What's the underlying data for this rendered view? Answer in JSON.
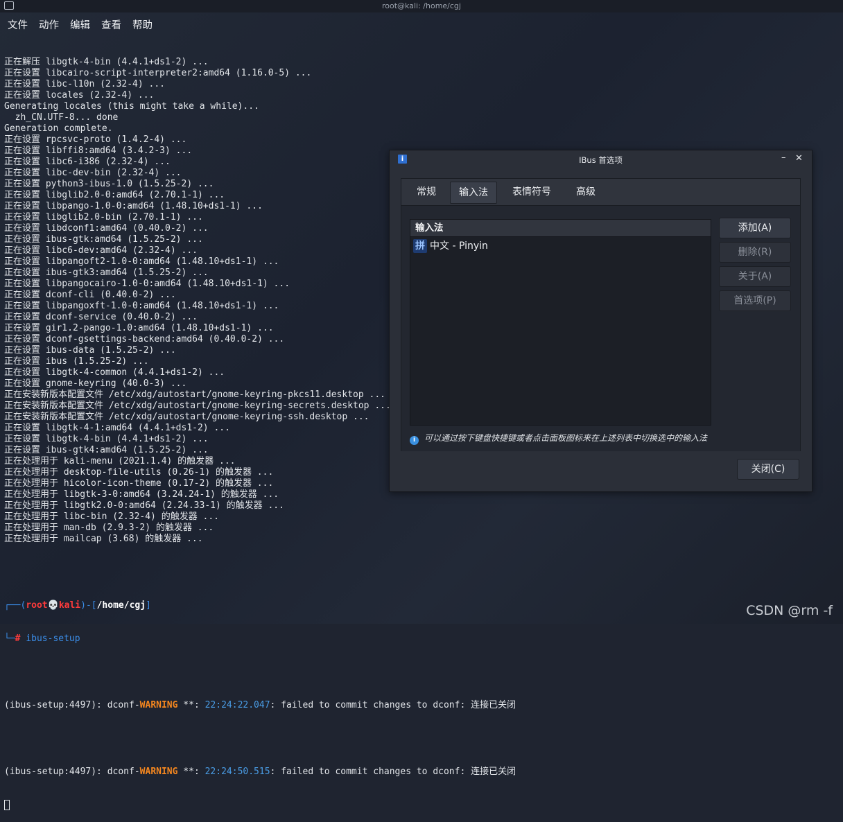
{
  "terminal": {
    "title": "root@kali: /home/cgj",
    "menu": [
      "文件",
      "动作",
      "编辑",
      "查看",
      "帮助"
    ],
    "lines": [
      "正在解压 libgtk-4-bin (4.4.1+ds1-2) ...",
      "正在设置 libcairo-script-interpreter2:amd64 (1.16.0-5) ...",
      "正在设置 libc-l10n (2.32-4) ...",
      "正在设置 locales (2.32-4) ...",
      "Generating locales (this might take a while)...",
      "  zh_CN.UTF-8... done",
      "Generation complete.",
      "正在设置 rpcsvc-proto (1.4.2-4) ...",
      "正在设置 libffi8:amd64 (3.4.2-3) ...",
      "正在设置 libc6-i386 (2.32-4) ...",
      "正在设置 libc-dev-bin (2.32-4) ...",
      "正在设置 python3-ibus-1.0 (1.5.25-2) ...",
      "正在设置 libglib2.0-0:amd64 (2.70.1-1) ...",
      "正在设置 libpango-1.0-0:amd64 (1.48.10+ds1-1) ...",
      "正在设置 libglib2.0-bin (2.70.1-1) ...",
      "正在设置 libdconf1:amd64 (0.40.0-2) ...",
      "正在设置 ibus-gtk:amd64 (1.5.25-2) ...",
      "正在设置 libc6-dev:amd64 (2.32-4) ...",
      "正在设置 libpangoft2-1.0-0:amd64 (1.48.10+ds1-1) ...",
      "正在设置 ibus-gtk3:amd64 (1.5.25-2) ...",
      "正在设置 libpangocairo-1.0-0:amd64 (1.48.10+ds1-1) ...",
      "正在设置 dconf-cli (0.40.0-2) ...",
      "正在设置 libpangoxft-1.0-0:amd64 (1.48.10+ds1-1) ...",
      "正在设置 dconf-service (0.40.0-2) ...",
      "正在设置 gir1.2-pango-1.0:amd64 (1.48.10+ds1-1) ...",
      "正在设置 dconf-gsettings-backend:amd64 (0.40.0-2) ...",
      "正在设置 ibus-data (1.5.25-2) ...",
      "正在设置 ibus (1.5.25-2) ...",
      "正在设置 libgtk-4-common (4.4.1+ds1-2) ...",
      "正在设置 gnome-keyring (40.0-3) ...",
      "正在安装新版本配置文件 /etc/xdg/autostart/gnome-keyring-pkcs11.desktop ...",
      "正在安装新版本配置文件 /etc/xdg/autostart/gnome-keyring-secrets.desktop ...",
      "正在安装新版本配置文件 /etc/xdg/autostart/gnome-keyring-ssh.desktop ...",
      "正在设置 libgtk-4-1:amd64 (4.4.1+ds1-2) ...",
      "正在设置 libgtk-4-bin (4.4.1+ds1-2) ...",
      "正在设置 ibus-gtk4:amd64 (1.5.25-2) ...",
      "正在处理用于 kali-menu (2021.1.4) 的触发器 ...",
      "正在处理用于 desktop-file-utils (0.26-1) 的触发器 ...",
      "正在处理用于 hicolor-icon-theme (0.17-2) 的触发器 ...",
      "正在处理用于 libgtk-3-0:amd64 (3.24.24-1) 的触发器 ...",
      "正在处理用于 libgtk2.0-0:amd64 (2.24.33-1) 的触发器 ...",
      "正在处理用于 libc-bin (2.32-4) 的触发器 ...",
      "正在处理用于 man-db (2.9.3-2) 的触发器 ...",
      "正在处理用于 mailcap (3.68) 的触发器 ..."
    ],
    "prompt": {
      "corner_top": "┌──(",
      "user": "root",
      "skull": "💀",
      "host": "kali",
      "mid": ")-[",
      "path": "/home/cgj",
      "end": "]",
      "corner_bottom": "└─",
      "hash": "#",
      "command": "ibus-setup"
    },
    "warnings": [
      {
        "prefix": "(ibus-setup:4497): dconf-",
        "level": "WARNING",
        "mid": " **: ",
        "time": "22:24:22.047",
        "msg": ": failed to commit changes to dconf: 连接已关闭"
      },
      {
        "prefix": "(ibus-setup:4497): dconf-",
        "level": "WARNING",
        "mid": " **: ",
        "time": "22:24:50.515",
        "msg": ": failed to commit changes to dconf: 连接已关闭"
      }
    ],
    "watermark": "CSDN @rm   -f"
  },
  "dialog": {
    "title": "IBus 首选项",
    "icon_glyph": "i",
    "minimize_glyph": "–",
    "close_glyph": "✕",
    "tabs": [
      "常规",
      "输入法",
      "表情符号",
      "高级"
    ],
    "active_tab": "输入法",
    "list_header": "输入法",
    "engines": [
      {
        "icon_glyph": "拼",
        "label": "中文 - Pinyin"
      }
    ],
    "buttons": [
      {
        "label": "添加(A)",
        "enabled": true
      },
      {
        "label": "删除(R)",
        "enabled": false
      },
      {
        "label": "关于(A)",
        "enabled": false
      },
      {
        "label": "首选项(P)",
        "enabled": false
      }
    ],
    "info_glyph": "i",
    "info_text": "可以通过按下键盘快捷键或者点击面板图标来在上述列表中切换选中的输入法",
    "close_button": "关闭(C)"
  }
}
